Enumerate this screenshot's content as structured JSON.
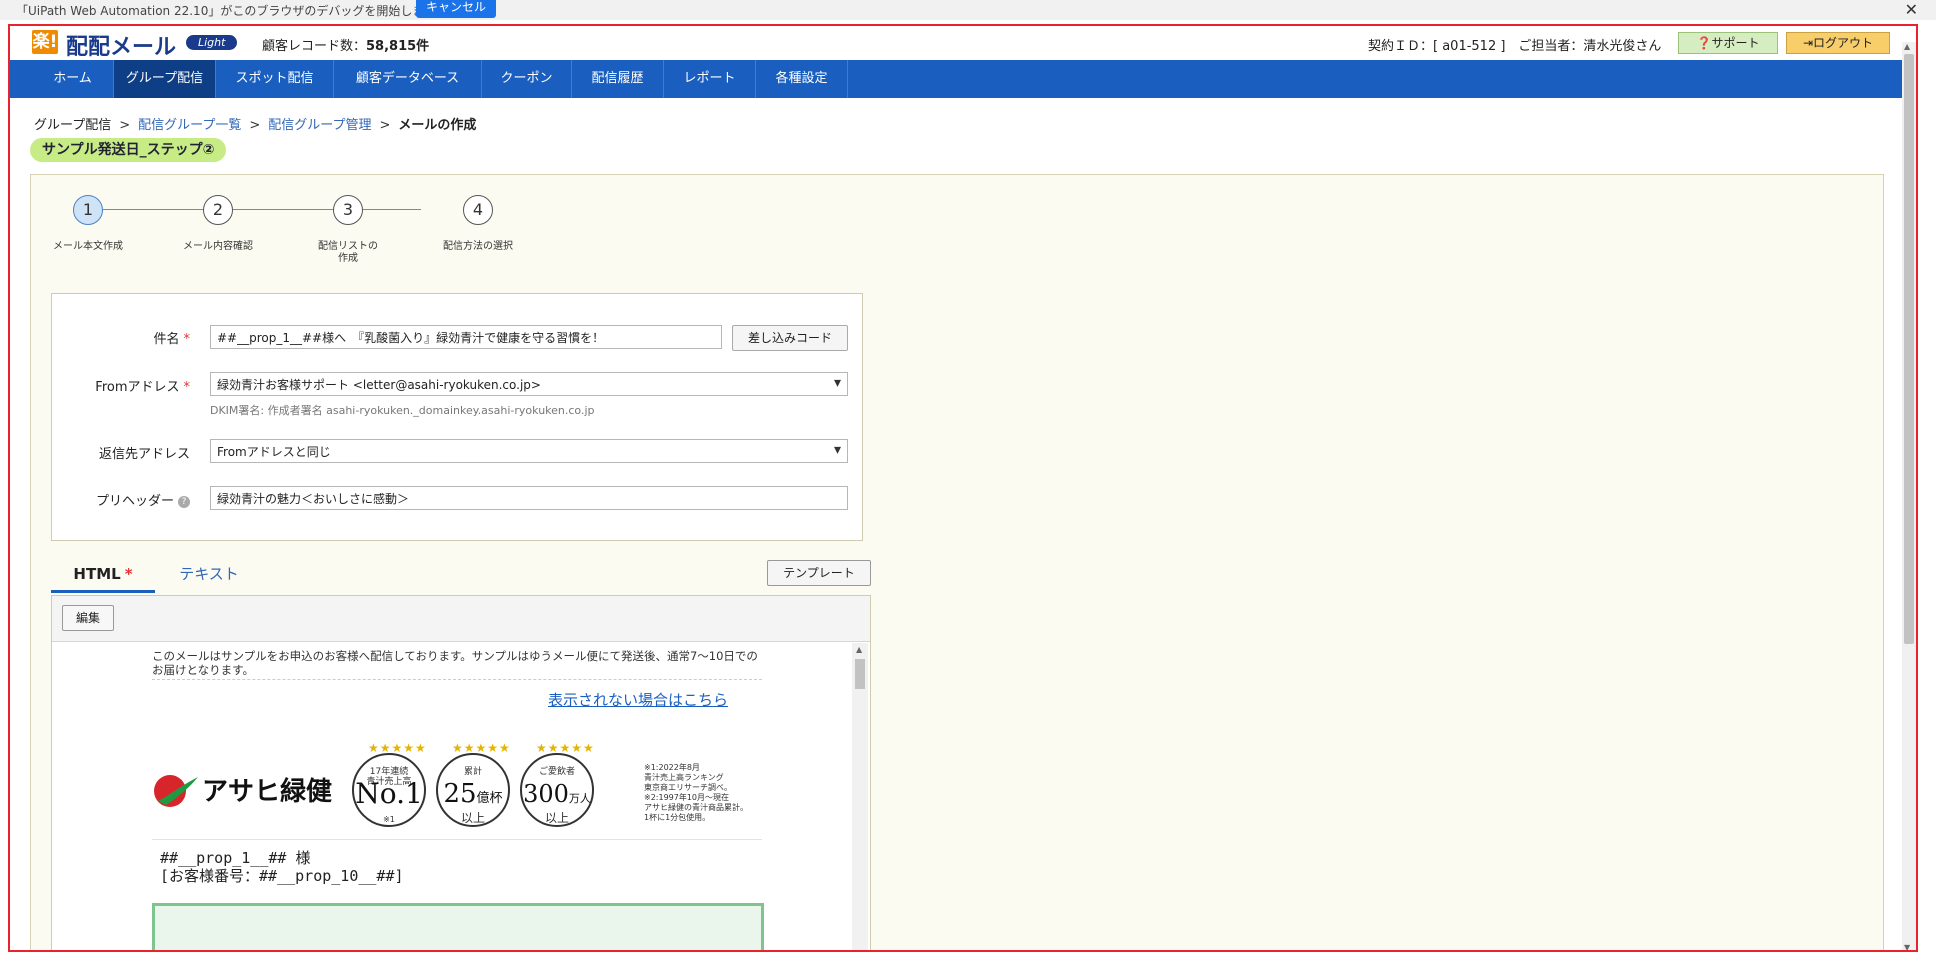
{
  "debug_bar": {
    "message": "「UiPath Web Automation 22.10」がこのブラウザのデバッグを開始しました",
    "cancel_label": "キャンセル",
    "close_glyph": "✕"
  },
  "header": {
    "logo_mark": "楽!",
    "logo_text": "配配メール",
    "logo_badge": "Light",
    "record_label": "顧客レコード数：",
    "record_count": "58,815件",
    "contract": "契約ＩＤ：[ a01-512 ]　ご担当者：清水光俊さん",
    "support_label": "サポート",
    "logout_label": "ログアウト"
  },
  "nav": {
    "items": [
      "ホーム",
      "グループ配信",
      "スポット配信",
      "顧客データベース",
      "クーポン",
      "配信履歴",
      "レポート",
      "各種設定"
    ],
    "active_index": 1
  },
  "breadcrumb": {
    "items": [
      "グループ配信",
      "配信グループ一覧",
      "配信グループ管理",
      "メールの作成"
    ],
    "separator": ">"
  },
  "group_title": "サンプル発送日_ステップ②",
  "steps": [
    {
      "number": "1",
      "label": "メール本文作成",
      "active": true
    },
    {
      "number": "2",
      "label": "メール内容確認",
      "active": false
    },
    {
      "number": "3",
      "label": "配信リストの\n作成",
      "active": false
    },
    {
      "number": "4",
      "label": "配信方法の選択",
      "active": false
    }
  ],
  "form": {
    "subject_label": "件名",
    "subject_value": "##__prop_1__##様へ　『乳酸菌入り』緑効青汁で健康を守る習慣を！",
    "insert_code_label": "差し込みコード",
    "from_label": "Fromアドレス",
    "from_value": "緑効青汁お客様サポート <letter@asahi-ryokuken.co.jp>",
    "dkim_text": "DKIM署名: 作成者署名 asahi-ryokuken._domainkey.asahi-ryokuken.co.jp",
    "reply_label": "返信先アドレス",
    "reply_value": "Fromアドレスと同じ",
    "preheader_label": "プリヘッダー",
    "preheader_value": "緑効青汁の魅力＜おいしさに感動＞",
    "required_mark": "*"
  },
  "tabs": {
    "html_label": "HTML",
    "text_label": "テキスト",
    "template_label": "テンプレート"
  },
  "editor": {
    "edit_label": "編集"
  },
  "preview": {
    "notice": "このメールはサンプルをお申込のお客様へ配信しております。サンプルはゆうメール便にて発送後、通常7～10日でのお届けとなります。",
    "link_text": "表示されない場合はこちら",
    "logo_text": "アサヒ緑健",
    "medals": [
      {
        "top": "17年連続\n青汁売上高",
        "big": "No.1",
        "bottom": "※1"
      },
      {
        "top": "累計",
        "big": "25",
        "bottom": "以上"
      },
      {
        "top": "ご愛飲者",
        "big": "300",
        "bottom": "以上"
      }
    ],
    "medal2_unit": "億杯",
    "medal3_unit": "万人",
    "notes": "※1:2022年8月\n青汁売上高ランキング\n東京商エリサーチ調べ。\n※2:1997年10月～現在\nアサヒ緑健の青汁商品累計。\n1杯に1分包使用。",
    "name_line": "##__prop_1__## 様",
    "customer_no": "[お客様番号：##__prop_10__##]"
  },
  "colors": {
    "nav_bg": "#1a5fc0",
    "nav_active": "#0e3f86",
    "frame_border": "#e8232c",
    "group_title_bg": "#c8ec85",
    "link": "#3267b8"
  }
}
